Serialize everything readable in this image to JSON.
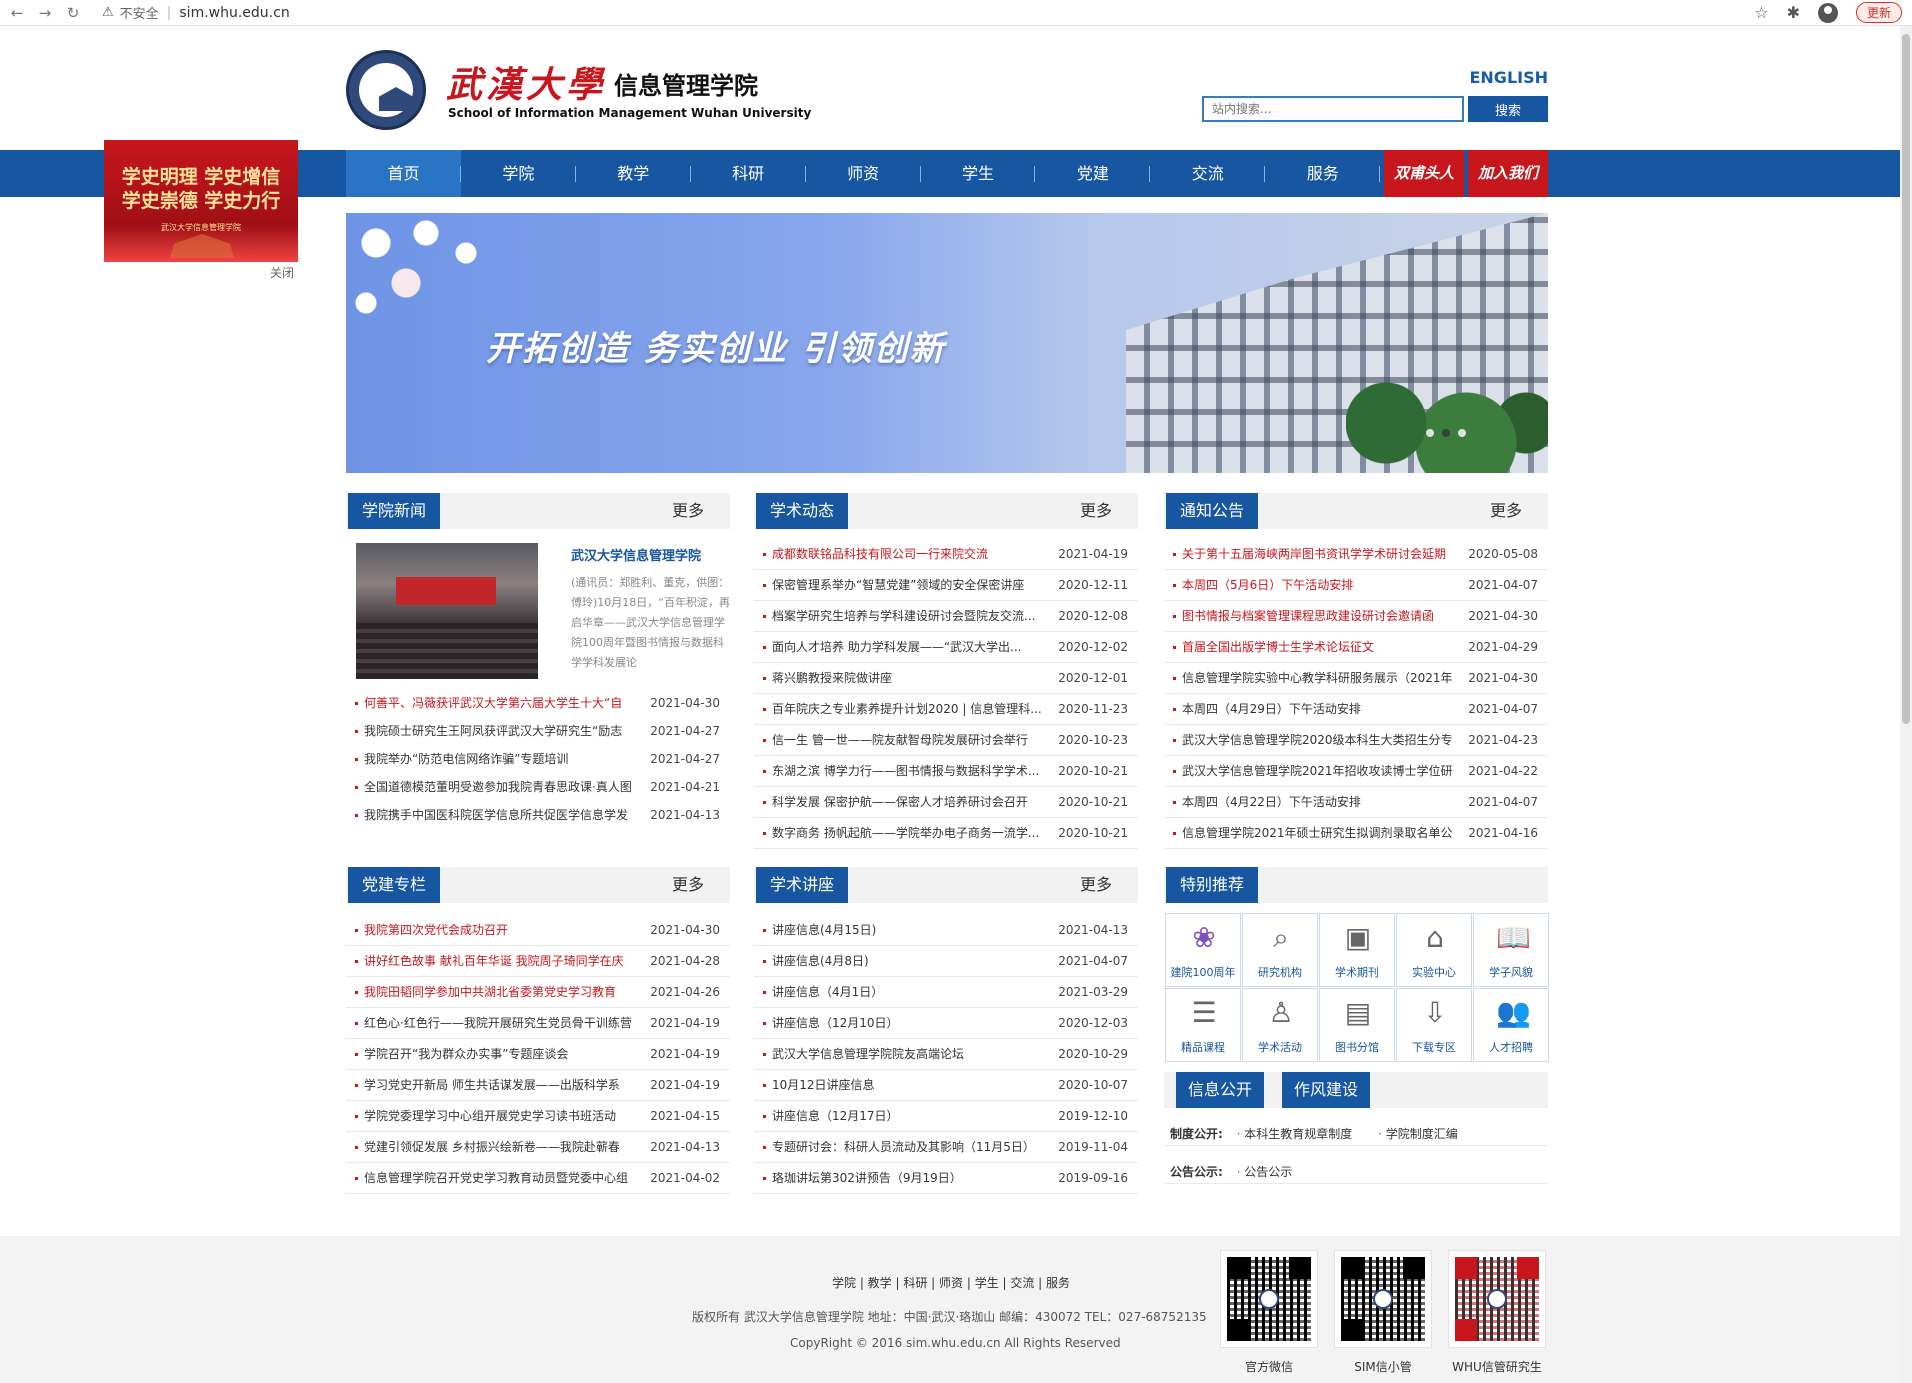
{
  "browser": {
    "insecure_label": "不安全",
    "url": "sim.whu.edu.cn",
    "update_label": "更新"
  },
  "header": {
    "univ_name": "武漢大學",
    "dept_name": "信息管理学院",
    "english_name": "School of Information Management Wuhan University",
    "english_link": "ENGLISH",
    "search_placeholder": "站内搜索...",
    "search_button": "搜索"
  },
  "nav": {
    "items": [
      "首页",
      "学院",
      "教学",
      "科研",
      "师资",
      "学生",
      "党建",
      "交流",
      "服务"
    ],
    "special": [
      "双甫头人",
      "加入我们"
    ]
  },
  "float_ad": {
    "line1": "学史明理 学史增信",
    "line2": "学史崇德 学史力行",
    "line3": "武汉大学信息管理学院",
    "close": "关闭"
  },
  "banner": {
    "slogan": "开拓创造  务实创业  引领创新"
  },
  "colors": {
    "brand_blue": "#1756a1",
    "accent_red": "#c8161d"
  },
  "college_news": {
    "title": "学院新闻",
    "more": "更多",
    "feature_title": "武汉大学信息管理学院",
    "feature_desc": "(通讯员：郑胜利、董克，供图：傅玲)10月18日，“百年积淀，再启华章——武汉大学信息管理学院100周年暨图书情报与数据科学学科发展论",
    "items": [
      {
        "title": "何善平、冯薇获评武汉大学第六届大学生十大“自",
        "date": "2021-04-30",
        "red": true
      },
      {
        "title": "我院硕士研究生王阿凤获评武汉大学研究生“励志",
        "date": "2021-04-27",
        "red": false
      },
      {
        "title": "我院举办“防范电信网络诈骗”专题培训",
        "date": "2021-04-27",
        "red": false
      },
      {
        "title": "全国道德模范董明受邀参加我院青春思政课·真人图",
        "date": "2021-04-21",
        "red": false
      },
      {
        "title": "我院携手中国医科院医学信息所共促医学信息学发",
        "date": "2021-04-13",
        "red": false
      }
    ]
  },
  "academic_news": {
    "title": "学术动态",
    "more": "更多",
    "items": [
      {
        "title": "成都数联铭品科技有限公司一行来院交流",
        "date": "2021-04-19",
        "red": true
      },
      {
        "title": "保密管理系举办“智慧党建”领域的安全保密讲座",
        "date": "2020-12-11",
        "red": false
      },
      {
        "title": "档案学研究生培养与学科建设研讨会暨院友交流...",
        "date": "2020-12-08",
        "red": false
      },
      {
        "title": "面向人才培养 助力学科发展——“武汉大学出...",
        "date": "2020-12-02",
        "red": false
      },
      {
        "title": "蒋兴鹏教授来院做讲座",
        "date": "2020-12-01",
        "red": false
      },
      {
        "title": "百年院庆之专业素养提升计划2020 | 信息管理科...",
        "date": "2020-11-23",
        "red": false
      },
      {
        "title": "信一生 管一世——院友献智母院发展研讨会举行",
        "date": "2020-10-23",
        "red": false
      },
      {
        "title": "东湖之滨 博学力行——图书情报与数据科学学术...",
        "date": "2020-10-21",
        "red": false
      },
      {
        "title": "科学发展 保密护航——保密人才培养研讨会召开",
        "date": "2020-10-21",
        "red": false
      },
      {
        "title": "数字商务 扬帆起航——学院举办电子商务一流学...",
        "date": "2020-10-21",
        "red": false
      }
    ]
  },
  "notices": {
    "title": "通知公告",
    "more": "更多",
    "items": [
      {
        "title": "关于第十五届海峡两岸图书资讯学学术研讨会延期",
        "date": "2020-05-08",
        "red": true
      },
      {
        "title": "本周四（5月6日）下午活动安排",
        "date": "2021-04-07",
        "red": true
      },
      {
        "title": "图书情报与档案管理课程思政建设研讨会邀请函",
        "date": "2021-04-30",
        "red": true
      },
      {
        "title": "首届全国出版学博士生学术论坛征文",
        "date": "2021-04-29",
        "red": true
      },
      {
        "title": "信息管理学院实验中心教学科研服务展示（2021年",
        "date": "2021-04-30",
        "red": false
      },
      {
        "title": "本周四（4月29日）下午活动安排",
        "date": "2021-04-07",
        "red": false
      },
      {
        "title": "武汉大学信息管理学院2020级本科生大类招生分专",
        "date": "2021-04-23",
        "red": false
      },
      {
        "title": "武汉大学信息管理学院2021年招收攻读博士学位研",
        "date": "2021-04-22",
        "red": false
      },
      {
        "title": "本周四（4月22日）下午活动安排",
        "date": "2021-04-07",
        "red": false
      },
      {
        "title": "信息管理学院2021年硕士研究生拟调剂录取名单公",
        "date": "2021-04-16",
        "red": false
      }
    ]
  },
  "party": {
    "title": "党建专栏",
    "more": "更多",
    "items": [
      {
        "title": "我院第四次党代会成功召开",
        "date": "2021-04-30",
        "red": true
      },
      {
        "title": "讲好红色故事 献礼百年华诞 我院周子琦同学在庆",
        "date": "2021-04-28",
        "red": true
      },
      {
        "title": "我院田韬同学参加中共湖北省委第党史学习教育",
        "date": "2021-04-26",
        "red": true
      },
      {
        "title": "红色心·红色行——我院开展研究生党员骨干训练营",
        "date": "2021-04-19",
        "red": false
      },
      {
        "title": "学院召开“我为群众办实事”专题座谈会",
        "date": "2021-04-19",
        "red": false
      },
      {
        "title": "学习党史开新局 师生共话谋发展——出版科学系",
        "date": "2021-04-19",
        "red": false
      },
      {
        "title": "学院党委理学习中心组开展党史学习读书班活动",
        "date": "2021-04-15",
        "red": false
      },
      {
        "title": "党建引领促发展 乡村振兴绘新卷——我院赴蕲春",
        "date": "2021-04-13",
        "red": false
      },
      {
        "title": "信息管理学院召开党史学习教育动员暨党委中心组",
        "date": "2021-04-02",
        "red": false
      }
    ]
  },
  "lectures": {
    "title": "学术讲座",
    "more": "更多",
    "items": [
      {
        "title": "讲座信息(4月15日)",
        "date": "2021-04-13",
        "red": false
      },
      {
        "title": "讲座信息(4月8日)",
        "date": "2021-04-07",
        "red": false
      },
      {
        "title": "讲座信息（4月1日）",
        "date": "2021-03-29",
        "red": false
      },
      {
        "title": "讲座信息（12月10日）",
        "date": "2020-12-03",
        "red": false
      },
      {
        "title": "武汉大学信息管理学院院友高端论坛",
        "date": "2020-10-29",
        "red": false
      },
      {
        "title": "10月12日讲座信息",
        "date": "2020-10-07",
        "red": false
      },
      {
        "title": "讲座信息（12月17日）",
        "date": "2019-12-10",
        "red": false
      },
      {
        "title": "专题研讨会：科研人员流动及其影响（11月5日）",
        "date": "2019-11-04",
        "red": false
      },
      {
        "title": "珞珈讲坛第302讲预告（9月19日）",
        "date": "2019-09-16",
        "red": false
      }
    ]
  },
  "recommend": {
    "title": "特别推荐",
    "cells": [
      {
        "label": "建院100周年",
        "icon": "100-anniversary-icon",
        "glyph": "❀"
      },
      {
        "label": "研究机构",
        "icon": "research-icon",
        "glyph": "⌕"
      },
      {
        "label": "学术期刊",
        "icon": "journal-icon",
        "glyph": "▣"
      },
      {
        "label": "实验中心",
        "icon": "lab-icon",
        "glyph": "⌂"
      },
      {
        "label": "学子风貌",
        "icon": "book-icon",
        "glyph": "📖"
      },
      {
        "label": "精品课程",
        "icon": "course-icon",
        "glyph": "☰"
      },
      {
        "label": "学术活动",
        "icon": "speaker-icon",
        "glyph": "♙"
      },
      {
        "label": "图书分馆",
        "icon": "library-icon",
        "glyph": "▤"
      },
      {
        "label": "下载专区",
        "icon": "download-icon",
        "glyph": "⇩"
      },
      {
        "label": "人才招聘",
        "icon": "people-icon",
        "glyph": "👥"
      }
    ]
  },
  "info": {
    "tab1": "信息公开",
    "tab2": "作风建设",
    "row1_key": "制度公开:",
    "row1_vals": [
      "本科生教育规章制度",
      "学院制度汇编"
    ],
    "row2_key": "公告公示:",
    "row2_vals": [
      "公告公示"
    ]
  },
  "footer": {
    "links": "学院 | 教学 | 科研 | 师资 | 学生 | 交流 | 服务",
    "copyright": "版权所有 武汉大学信息管理学院  地址：中国·武汉·珞珈山  邮编：430072  TEL：027-68752135",
    "copyright2": "CopyRight © 2016 sim.whu.edu.cn All Rights Reserved",
    "qrs": [
      "官方微信",
      "SIM信小管",
      "WHU信管研究生"
    ]
  }
}
